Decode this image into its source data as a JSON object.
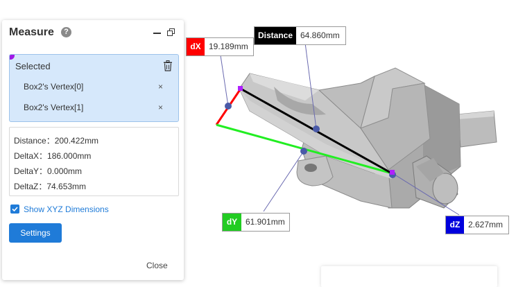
{
  "panel": {
    "title": "Measure",
    "help_icon": "?",
    "selected_label": "Selected",
    "selected_items": [
      "Box2's Vertex[0]",
      "Box2's Vertex[1]"
    ],
    "remove_glyph": "×",
    "results": [
      "Distance：200.422mm",
      "DeltaX：186.000mm",
      "DeltaY：0.000mm",
      "DeltaZ：74.653mm"
    ],
    "show_xyz_label": "Show XYZ Dimensions",
    "show_xyz_checked": true,
    "settings_label": "Settings",
    "close_label": "Close"
  },
  "labels": {
    "dx": {
      "tag": "dX",
      "value": "19.189mm",
      "color": "#ff0000"
    },
    "distance": {
      "tag": "Distance",
      "value": "64.860mm",
      "color": "#000000"
    },
    "dy": {
      "tag": "dY",
      "value": "61.901mm",
      "color": "#22cc22"
    },
    "dz": {
      "tag": "dZ",
      "value": "2.627mm",
      "color": "#0000dd"
    }
  },
  "colors": {
    "accent": "#1f7bd8",
    "selection_bg": "#d6e8fb",
    "vertex_marker": "#a019e6",
    "leader_point": "#4a5aa8",
    "part_gray": "#b0b0b0"
  }
}
